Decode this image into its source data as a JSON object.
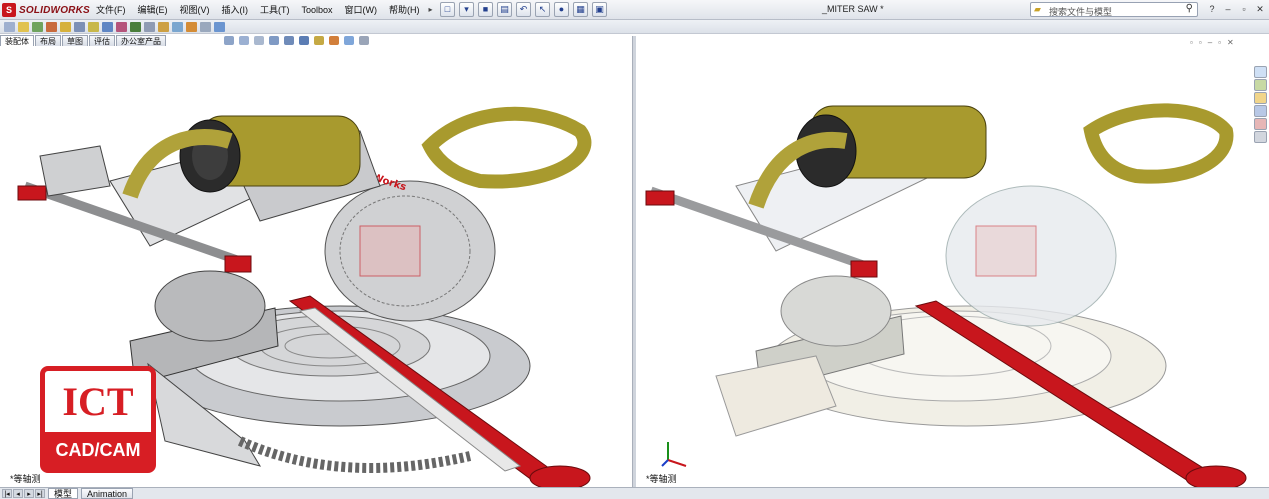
{
  "app": {
    "logo_text": "SOLIDWORKS",
    "document_title": "_MITER SAW *"
  },
  "menu": [
    "文件(F)",
    "编辑(E)",
    "视图(V)",
    "插入(I)",
    "工具(T)",
    "Toolbox",
    "窗口(W)",
    "帮助(H)"
  ],
  "search": {
    "placeholder": "搜索文件与模型"
  },
  "command_tabs": [
    "装配体",
    "布局",
    "草图",
    "评估",
    "办公室产品"
  ],
  "active_command_tab": "装配体",
  "viewports": {
    "left": {
      "view_label": "*等轴测",
      "shading": "shaded"
    },
    "right": {
      "view_label": "*等轴测",
      "shading": "transparent"
    }
  },
  "bottom_tabs": [
    "模型",
    "Animation"
  ],
  "active_bottom_tab": "模型",
  "badge": {
    "top_text": "ICT",
    "bottom_text": "CAD/CAM"
  },
  "colors": {
    "brand_red": "#d71e24",
    "motor_yellow": "#a89a2e",
    "accent_red": "#c8161d"
  },
  "model_label": "SolidWorks"
}
